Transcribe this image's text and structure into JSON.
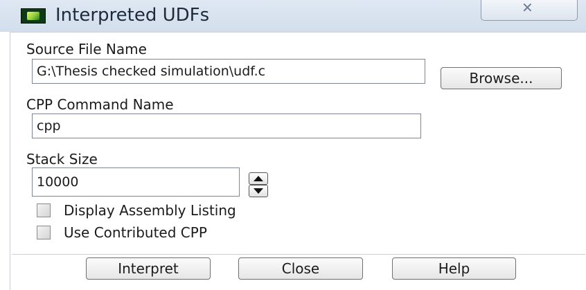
{
  "window": {
    "title": "Interpreted UDFs",
    "close_glyph": "✕"
  },
  "source_file": {
    "label": "Source File Name",
    "value": "G:\\Thesis checked simulation\\udf.c",
    "browse_label": "Browse..."
  },
  "cpp_command": {
    "label": "CPP Command Name",
    "value": "cpp"
  },
  "stack_size": {
    "label": "Stack Size",
    "value": "10000"
  },
  "options": [
    {
      "label": "Display Assembly Listing",
      "checked": false
    },
    {
      "label": "Use Contributed CPP",
      "checked": false
    }
  ],
  "buttons": {
    "interpret": "Interpret",
    "close": "Close",
    "help": "Help"
  },
  "icons": {
    "app": "fluent-app-icon",
    "close": "close-icon",
    "spin_up": "arrow-up-icon",
    "spin_down": "arrow-down-icon"
  }
}
